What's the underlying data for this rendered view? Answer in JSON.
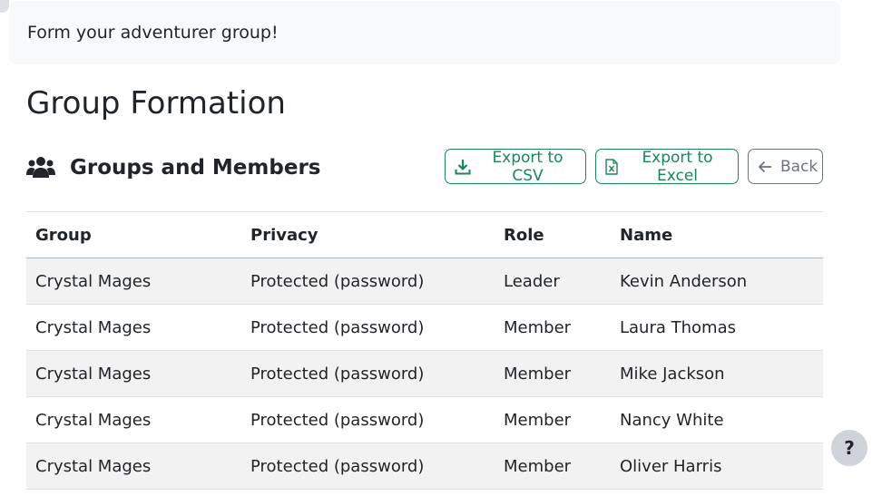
{
  "alert": {
    "text": "Form your adventurer group!"
  },
  "page": {
    "title": "Group Formation"
  },
  "section": {
    "title": "Groups and Members",
    "icon": "users-icon"
  },
  "toolbar": {
    "export_csv_label": "Export to CSV",
    "export_excel_label": "Export to Excel",
    "back_label": "Back"
  },
  "table": {
    "columns": [
      "Group",
      "Privacy",
      "Role",
      "Name"
    ],
    "rows": [
      {
        "group": "Crystal Mages",
        "privacy": "Protected (password)",
        "role": "Leader",
        "name": "Kevin Anderson"
      },
      {
        "group": "Crystal Mages",
        "privacy": "Protected (password)",
        "role": "Member",
        "name": "Laura Thomas"
      },
      {
        "group": "Crystal Mages",
        "privacy": "Protected (password)",
        "role": "Member",
        "name": "Mike Jackson"
      },
      {
        "group": "Crystal Mages",
        "privacy": "Protected (password)",
        "role": "Member",
        "name": "Nancy White"
      },
      {
        "group": "Crystal Mages",
        "privacy": "Protected (password)",
        "role": "Member",
        "name": "Oliver Harris"
      }
    ]
  },
  "help": {
    "label": "?"
  },
  "colors": {
    "success": "#198754",
    "secondary": "#6c757d",
    "alert_bg": "#f8f9fa",
    "stripe": "#f2f2f2"
  }
}
